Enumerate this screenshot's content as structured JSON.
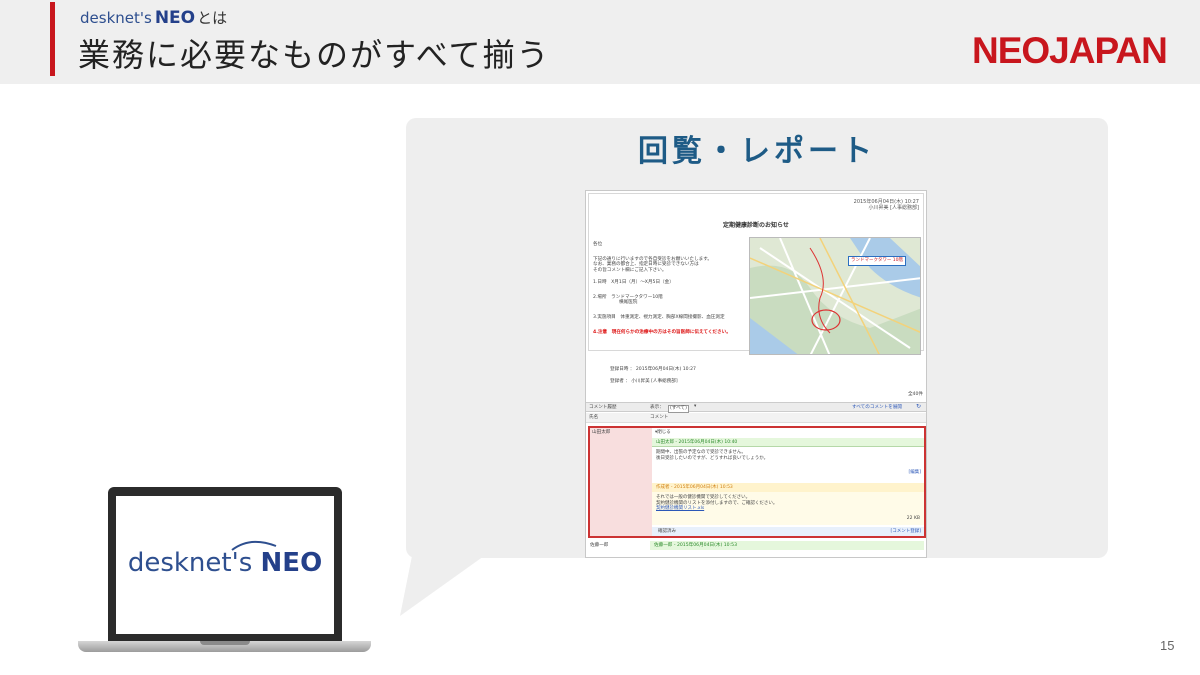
{
  "header": {
    "brand_prefix": "desknet's",
    "brand_name": "NEO",
    "brand_suffix": "とは",
    "title": "業務に必要なものがすべて揃う",
    "company_logo": "NEOJAPAN"
  },
  "panel": {
    "title": "回覧・レポート"
  },
  "screenshot": {
    "doc_date": "2015年06月04日(木) 10:27",
    "doc_author": "小川昇美 [人事総務部]",
    "doc_title": "定期健康診断のお知らせ",
    "greeting": "各位",
    "intro_lines": [
      "下記の通りに行いますので各自受診をお願いいたします。",
      "なお、業務の都合上、指定日時に受診できない方は",
      "その旨コメント欄にご記入下さい。"
    ],
    "item_date": "1.日時　X月1日（月）～X月5日（金）",
    "item_place": "2.場所　ランドマークタワー10階",
    "item_place_sub": "横尾医院",
    "item_content": "3.実施項目　体重測定、視力測定、胸部X線間接撮影、血圧測定",
    "item_note": "4.注意　現在何らかの治療中の方はその旨医師に伝えてください。",
    "map_label": "ランドマークタワー 10階",
    "registered_at": "登録日時 ： 2015年06月04日(木) 10:27",
    "registered_by": "登録者 ： 小川昇美 [人事総務部]",
    "count": "全40件",
    "comment_bar": {
      "label": "コメント履歴",
      "display_label": "表示：",
      "display_value": "(すべて)",
      "expand_all": "すべてのコメントを展開"
    },
    "comment_head": {
      "name_col": "氏名",
      "comment_col": "コメント"
    },
    "comment_block": {
      "name": "山田太郎",
      "toggle": "▾閉じる",
      "msg1_header": "山田太郎 - 2015年06月04日(木) 10:40",
      "msg1_line1": "期間中、出張の予定なので受診できません。",
      "msg1_line2": "後日受診したいのですが、どうすれば良いでしょうか。",
      "msg1_edit": "[編集]",
      "msg2_header": "作成者 - 2015年06月04日(木) 10:53",
      "msg2_line1": "それでは一般の健診機関で受診してください。",
      "msg2_line2": "契約健診機関のリストを添付しますので、ご確認ください。",
      "msg2_link": "契約健診機関リスト.xls",
      "msg2_size": "22 KB",
      "confirm": "確認済み",
      "register_comment": "[コメント登録]"
    },
    "next_row": {
      "name": "佐藤一郎",
      "header": "佐藤一郎 - 2015年06月04日(木) 10:53"
    }
  },
  "laptop": {
    "logo_prefix": "desknet's",
    "logo_name": "NEO"
  },
  "page_number": "15",
  "colors": {
    "accent_red": "#c8161d",
    "brand_blue": "#24408a",
    "panel_title_blue": "#1e5b86"
  }
}
